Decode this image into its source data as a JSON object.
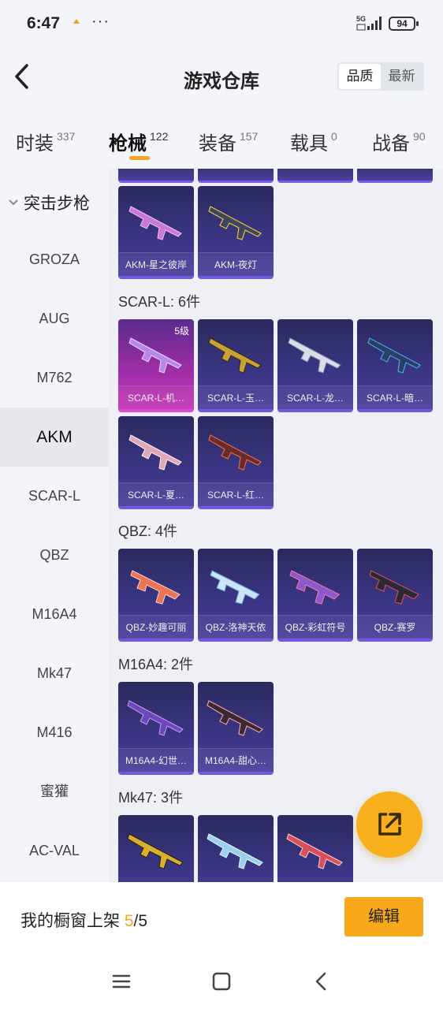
{
  "status_bar": {
    "time": "6:47",
    "more": "···",
    "network": "5G",
    "battery": "94"
  },
  "header": {
    "title": "游戏仓库",
    "sort_options": [
      "品质",
      "最新"
    ],
    "sort_active": "品质"
  },
  "tabs": [
    {
      "label": "时装",
      "count": "337"
    },
    {
      "label": "枪械",
      "count": "122",
      "active": true
    },
    {
      "label": "装备",
      "count": "157"
    },
    {
      "label": "载具",
      "count": "0"
    },
    {
      "label": "战备",
      "count": "90"
    }
  ],
  "sidebar": {
    "group": "突击步枪",
    "items": [
      "GROZA",
      "AUG",
      "M762",
      "AKM",
      "SCAR-L",
      "QBZ",
      "M16A4",
      "Mk47",
      "M416",
      "蜜獾",
      "AC-VAL"
    ],
    "active": "AKM"
  },
  "sections": {
    "akm": {
      "cards": [
        {
          "label": "AKM-星之彼岸"
        },
        {
          "label": "AKM-夜灯"
        }
      ]
    },
    "scar": {
      "title": "SCAR-L: 6件",
      "cards": [
        {
          "label": "SCAR-L-机…",
          "level": "5级"
        },
        {
          "label": "SCAR-L-玉…"
        },
        {
          "label": "SCAR-L-龙…"
        },
        {
          "label": "SCAR-L-暗…"
        },
        {
          "label": "SCAR-L-夏…"
        },
        {
          "label": "SCAR-L-红…"
        }
      ]
    },
    "qbz": {
      "title": "QBZ: 4件",
      "cards": [
        {
          "label": "QBZ-妙趣可丽"
        },
        {
          "label": "QBZ-洛神天依"
        },
        {
          "label": "QBZ-彩虹符号"
        },
        {
          "label": "QBZ-赛罗"
        }
      ]
    },
    "m16": {
      "title": "M16A4: 2件",
      "cards": [
        {
          "label": "M16A4-幻世…"
        },
        {
          "label": "M16A4-甜心…"
        }
      ]
    },
    "mk47": {
      "title": "Mk47: 3件"
    }
  },
  "bottom": {
    "shelf_prefix": "我的橱窗上架 ",
    "shelf_count": "5",
    "shelf_total": "/5",
    "edit_label": "编辑"
  },
  "colors": {
    "accent": "#f5a623",
    "card_bg": "#3b3585",
    "card_pink": "#c436b6"
  }
}
